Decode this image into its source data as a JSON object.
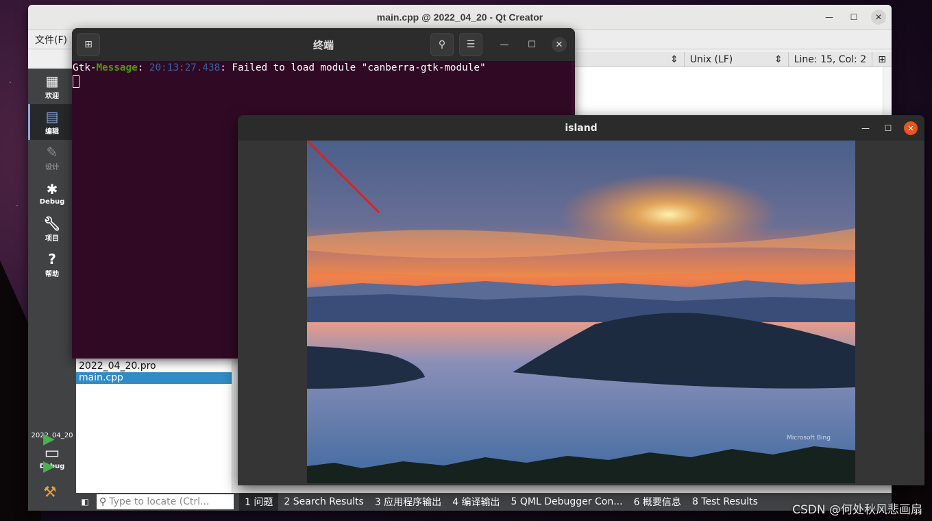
{
  "qt": {
    "title": "main.cpp @ 2022_04_20 - Qt Creator",
    "menu_file": "文件(F)",
    "line_ending": "Unix (LF)",
    "cursor_pos": "Line: 15, Col: 2",
    "modes": {
      "welcome": "欢迎",
      "edit": "编辑",
      "design": "设计",
      "debug": "Debug",
      "projects": "项目",
      "help": "帮助"
    },
    "target": {
      "project": "2022_04_20",
      "mode": "Debug"
    },
    "project_files": [
      "2022_04_20.pro",
      "main.cpp"
    ],
    "locator_placeholder": "Type to locate (Ctrl...",
    "output_tabs": [
      "1 问题",
      "2 Search Results",
      "3 应用程序输出",
      "4 编译输出",
      "5 QML Debugger Con...",
      "6 概要信息",
      "8 Test Results"
    ]
  },
  "terminal": {
    "title": "终端",
    "line": {
      "prefix1": "Gtk-",
      "prefix2": "Message",
      "colon": ": ",
      "time": "20:13:27.438",
      "msg": ": Failed to load module \"canberra-gtk-module\""
    }
  },
  "island": {
    "title": "island",
    "photo_credit": "Microsoft Bing"
  },
  "watermark": "CSDN @何处秋风悲画扇"
}
